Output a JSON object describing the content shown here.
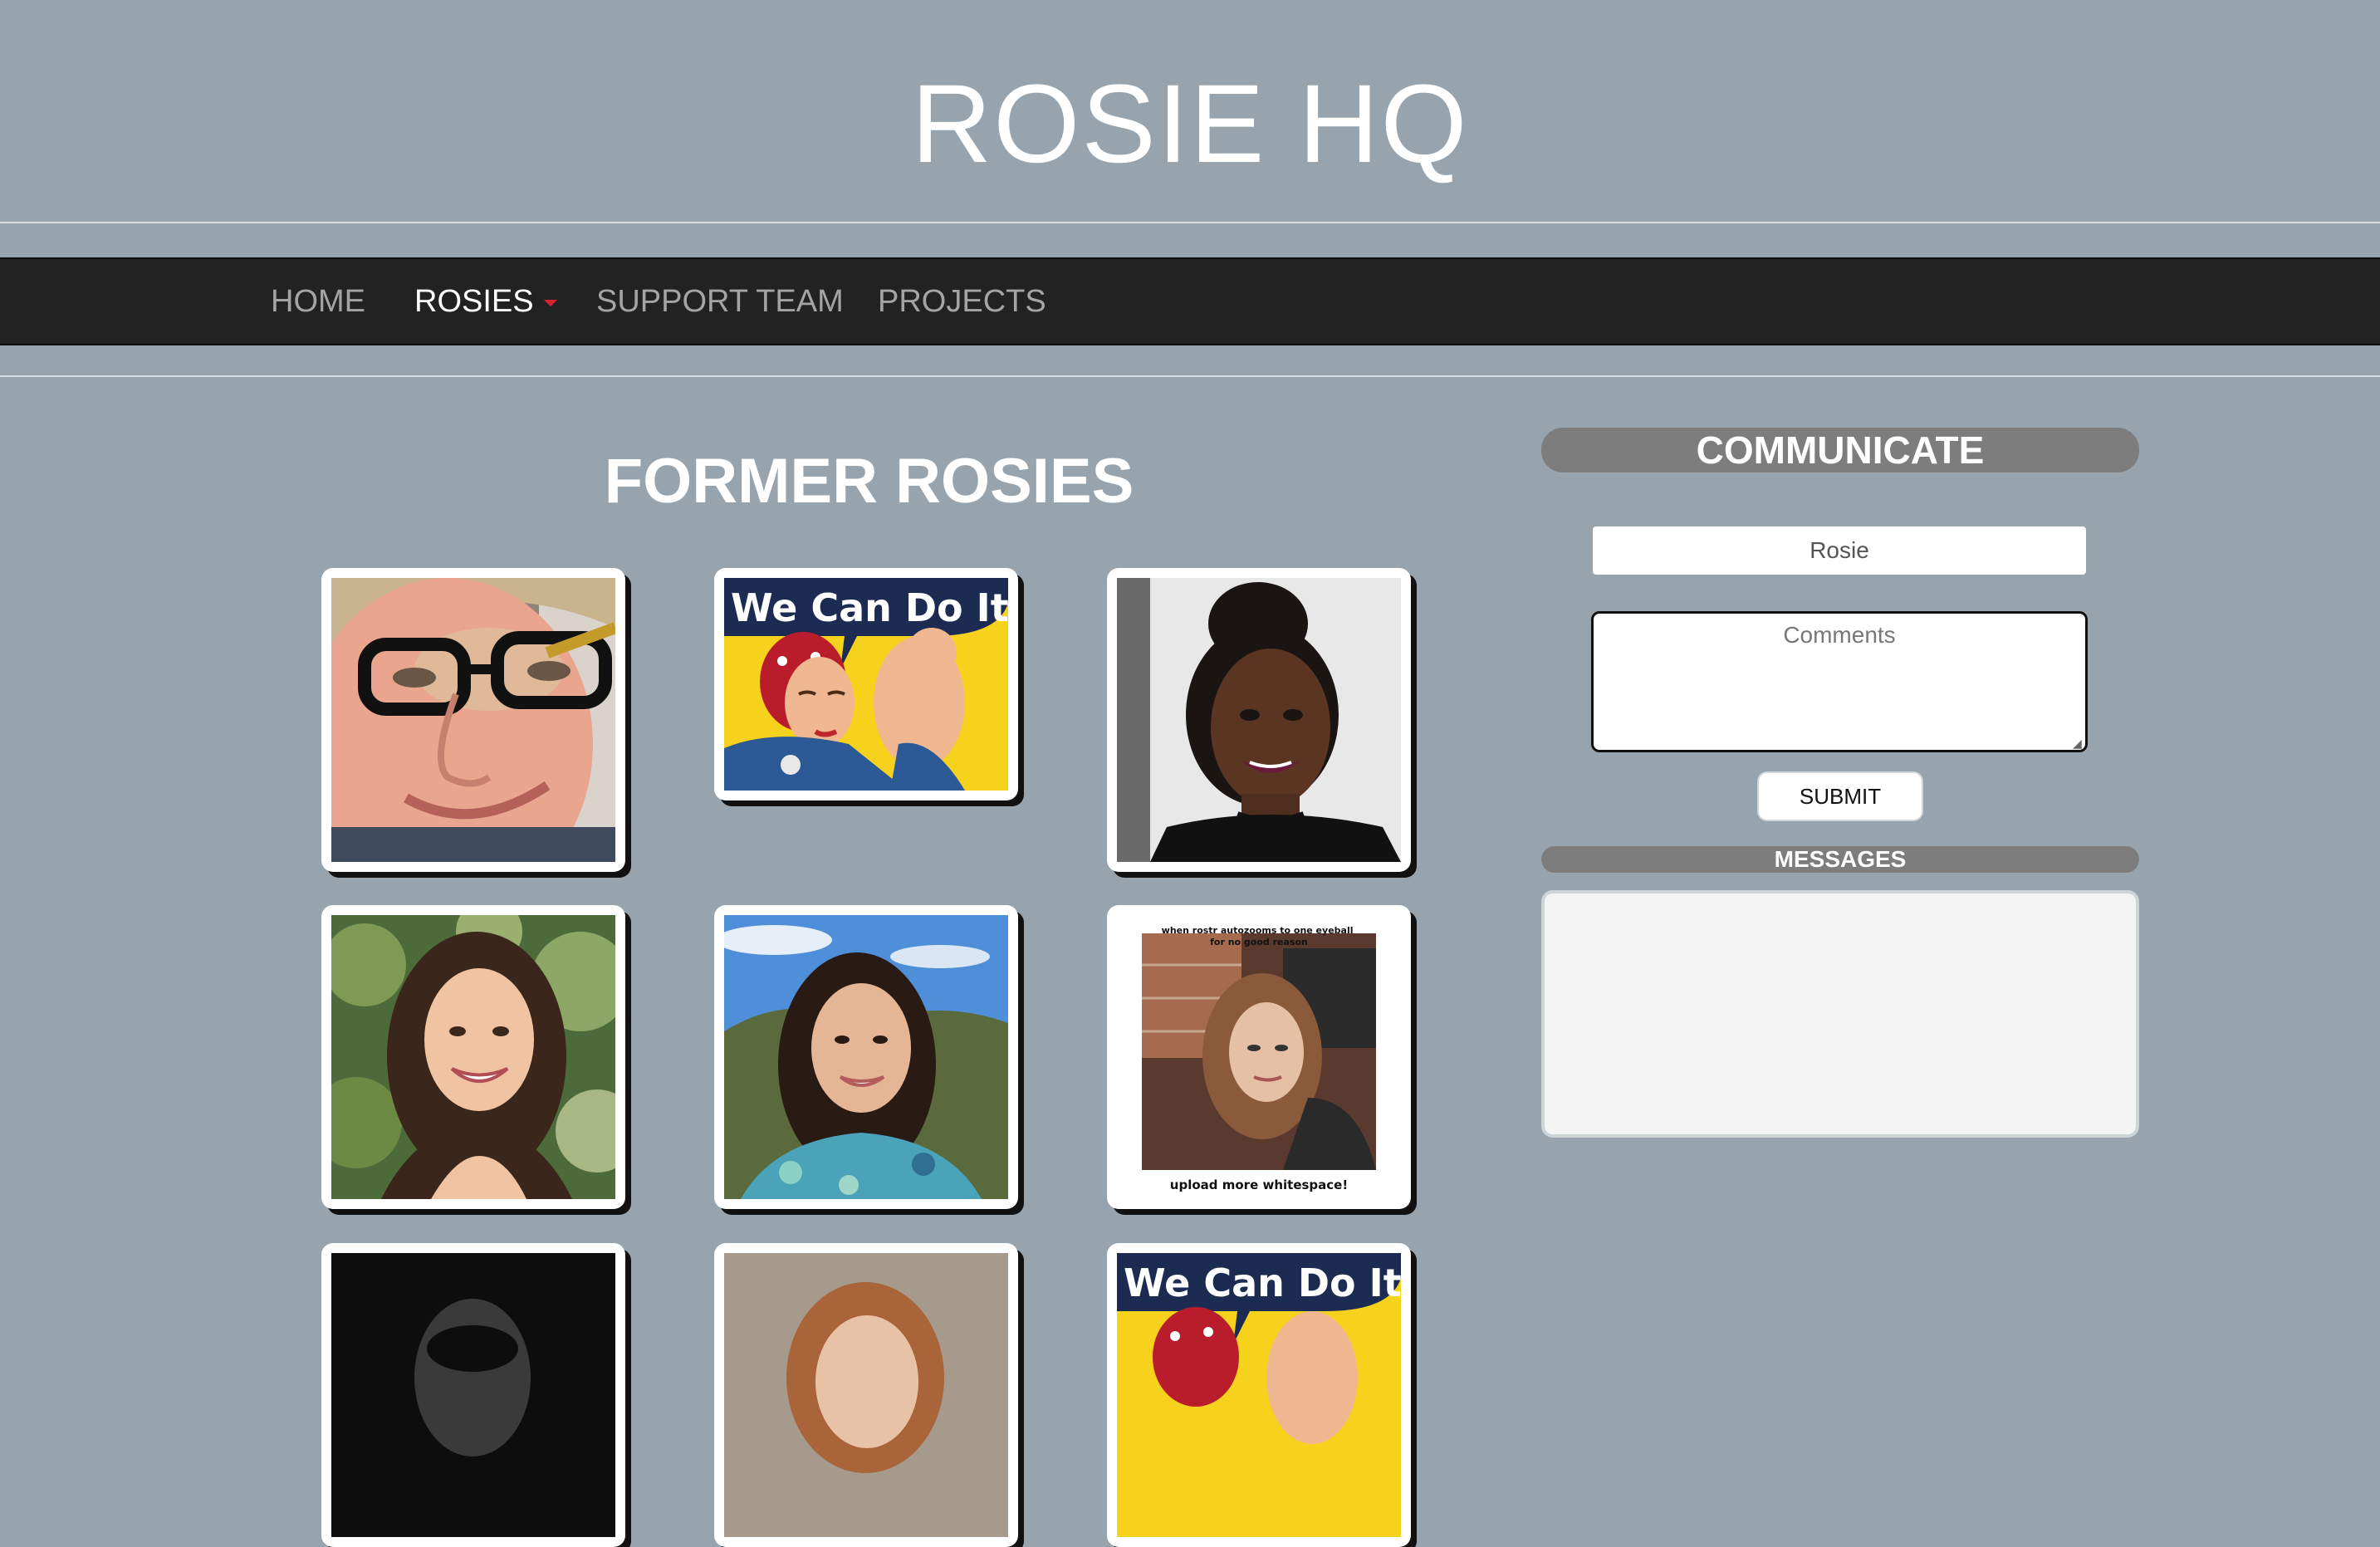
{
  "header": {
    "title": "ROSIE HQ"
  },
  "nav": {
    "items": [
      {
        "label": "HOME",
        "active": false,
        "has_caret": false
      },
      {
        "label": "ROSIES",
        "active": true,
        "has_caret": true
      },
      {
        "label": "SUPPORT TEAM",
        "active": false,
        "has_caret": false
      },
      {
        "label": "PROJECTS",
        "active": false,
        "has_caret": false
      }
    ],
    "caret_color": "#d9232e"
  },
  "main": {
    "section_title": "FORMER ROSIES",
    "photos": [
      {
        "kind": "portrait",
        "description": "woman-with-glasses"
      },
      {
        "kind": "poster",
        "text": "We Can Do It!"
      },
      {
        "kind": "portrait",
        "description": "woman-with-updo"
      },
      {
        "kind": "portrait",
        "description": "woman-long-dark-hair-foliage"
      },
      {
        "kind": "portrait",
        "description": "woman-curly-hair-outdoors"
      },
      {
        "kind": "meme",
        "top_text": "when rostr autozooms to one eyeball\nfor no good reason",
        "bottom_text": "upload more whitespace!"
      },
      {
        "kind": "portrait",
        "description": "black-and-white-portrait"
      },
      {
        "kind": "portrait",
        "description": "woman-auburn-hair"
      },
      {
        "kind": "poster",
        "text": "We Can Do It!"
      }
    ]
  },
  "sidebar": {
    "communicate_label": "COMMUNICATE",
    "name_value": "Rosie",
    "comments_placeholder": "Comments",
    "submit_label": "SUBMIT",
    "messages_label": "MESSAGES"
  },
  "colors": {
    "page_background": "#97a4ad",
    "navbar_background": "#222222",
    "panel_header": "#7d7d7d",
    "poster_yellow": "#f7d21c",
    "poster_navy": "#1c2b52"
  }
}
